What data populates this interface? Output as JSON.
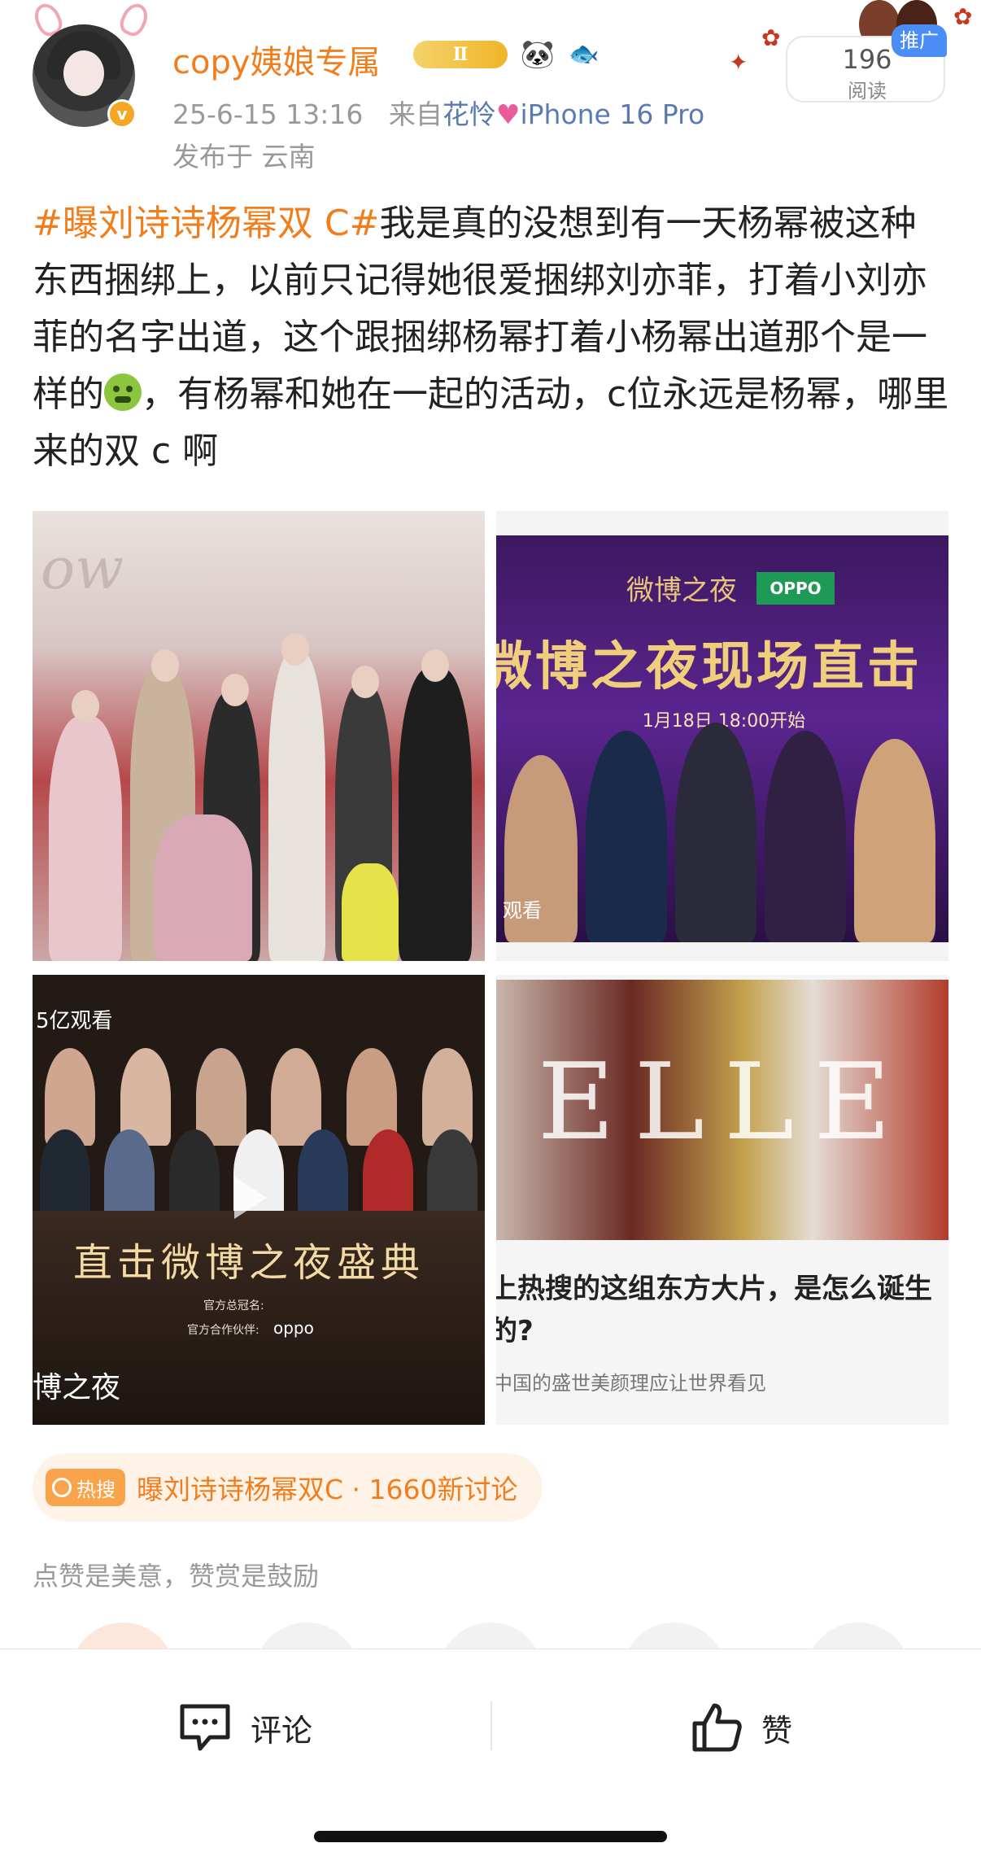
{
  "author": {
    "name": "copy姨娘专属",
    "level_badge": "Ⅱ",
    "time": "25-6-15 13:16",
    "via_prefix": "来自",
    "via_user": "花怜",
    "device": "iPhone 16 Pro",
    "location": "发布于 云南",
    "verified_mark": "v"
  },
  "stats": {
    "read_count": "196",
    "read_label": "阅读",
    "promo_tag": "推广"
  },
  "post": {
    "hashtag": "#曝刘诗诗杨幂双 C#",
    "text_part1": "我是真的没想到有一天杨幂被这种东西捆绑上，以前只记得她很爱捆绑刘亦菲，打着小刘亦菲的名字出道，这个跟捆绑杨幂打着小杨幂出道那个是一样的",
    "text_part2": "，有杨幂和她在一起的活动，c位永远是杨幂，哪里来的双 c 啊"
  },
  "images": {
    "img1_letters": "ow",
    "img2_logo": "微博之夜",
    "img2_brand": "OPPO",
    "img2_title": "微博之夜现场直击",
    "img2_time": "1月18日  18:00开始",
    "img2_corner": "观看",
    "img3_views": "5亿观看",
    "img3_title": "直击微博之夜盛典",
    "img3_sponsor1": "官方总冠名:",
    "img3_sponsor2": "官方合作伙伴:",
    "img3_brand": "oppo",
    "img3_bottom": "博之夜",
    "img4_brand": "ELLE",
    "img4_caption": "上热搜的这组东方大片，是怎么诞生的?",
    "img4_sub": "中国的盛世美颜理应让世界看见"
  },
  "hot_search": {
    "badge": "热搜",
    "text": "曝刘诗诗杨幂双C · 1660新讨论"
  },
  "appreciate": "点赞是美意，赞赏是鼓励",
  "bottom_bar": {
    "comment_label": "评论",
    "like_label": "赞"
  },
  "colors": {
    "accent": "#f27d1d",
    "link": "#5b7ab0",
    "meta": "#999999"
  }
}
